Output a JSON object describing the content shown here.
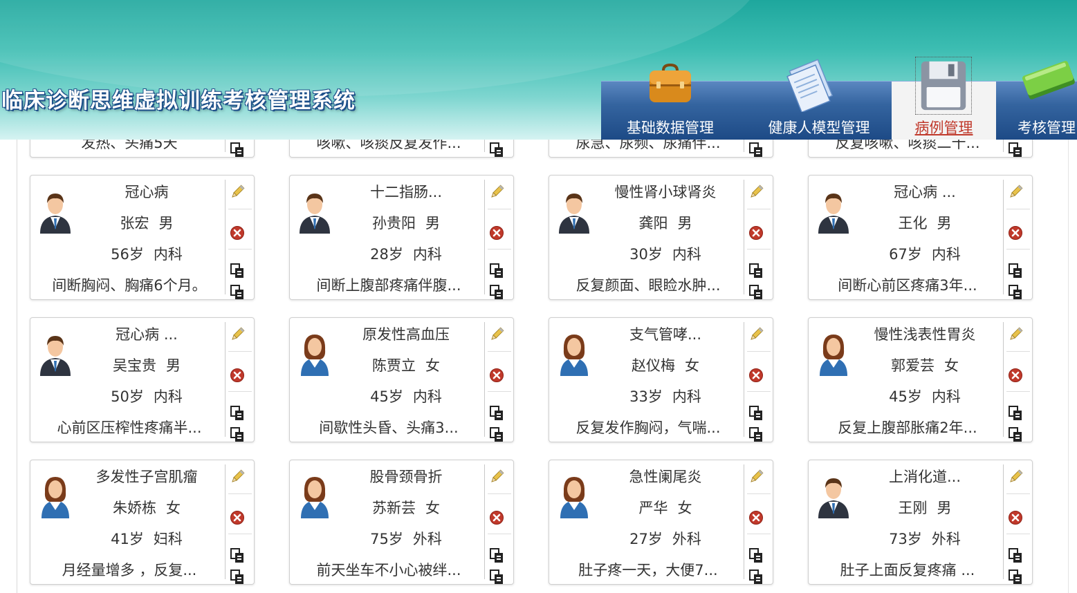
{
  "header": {
    "app_title": "临床诊断思维虚拟训练考核管理系统",
    "nav": [
      {
        "label": "基础数据管理",
        "icon": "briefcase-icon"
      },
      {
        "label": "健康人模型管理",
        "icon": "documents-icon"
      },
      {
        "label": "病例管理",
        "icon": "floppy-disk-icon",
        "active": true
      },
      {
        "label": "考核管理",
        "icon": "book-icon"
      }
    ]
  },
  "partial_row": [
    {
      "desc": "发热、头痛5天"
    },
    {
      "desc": "咳嗽、咳痰反复发作..."
    },
    {
      "desc": "尿急、尿频、尿痛伴..."
    },
    {
      "desc": "反复咳嗽、咳痰二十..."
    }
  ],
  "cases": [
    {
      "diagnosis": "冠心病",
      "name": "张宏",
      "gender": "男",
      "age": "56岁",
      "dept": "内科",
      "desc": "间断胸闷、胸痛6个月。"
    },
    {
      "diagnosis": "十二指肠...",
      "name": "孙贵阳",
      "gender": "男",
      "age": "28岁",
      "dept": "内科",
      "desc": "间断上腹部疼痛伴腹..."
    },
    {
      "diagnosis": "慢性肾小球肾炎",
      "name": "龚阳",
      "gender": "男",
      "age": "30岁",
      "dept": "内科",
      "desc": "反复颜面、眼睑水肿..."
    },
    {
      "diagnosis": "冠心病 ...",
      "name": "王化",
      "gender": "男",
      "age": "67岁",
      "dept": "内科",
      "desc": "间断心前区疼痛3年..."
    },
    {
      "diagnosis": "冠心病 ...",
      "name": "吴宝贵",
      "gender": "男",
      "age": "50岁",
      "dept": "内科",
      "desc": "心前区压榨性疼痛半..."
    },
    {
      "diagnosis": "原发性高血压",
      "name": "陈贾立",
      "gender": "女",
      "age": "45岁",
      "dept": "内科",
      "desc": "间歇性头昏、头痛3..."
    },
    {
      "diagnosis": "支气管哮...",
      "name": "赵仪梅",
      "gender": "女",
      "age": "33岁",
      "dept": "内科",
      "desc": "反复发作胸闷，气喘..."
    },
    {
      "diagnosis": "慢性浅表性胃炎",
      "name": "郭爱芸",
      "gender": "女",
      "age": "45岁",
      "dept": "内科",
      "desc": "反复上腹部胀痛2年..."
    },
    {
      "diagnosis": "多发性子宫肌瘤",
      "name": "朱娇栋",
      "gender": "女",
      "age": "41岁",
      "dept": "妇科",
      "desc": "月经量增多 ，反复..."
    },
    {
      "diagnosis": "股骨颈骨折",
      "name": "苏新芸",
      "gender": "女",
      "age": "75岁",
      "dept": "外科",
      "desc": "前天坐车不小心被绊..."
    },
    {
      "diagnosis": "急性阑尾炎",
      "name": "严华",
      "gender": "女",
      "age": "27岁",
      "dept": "外科",
      "desc": "肚子疼一天，大便7..."
    },
    {
      "diagnosis": "上消化道...",
      "name": "王刚",
      "gender": "男",
      "age": "73岁",
      "dept": "外科",
      "desc": "肚子上面反复疼痛 ..."
    }
  ],
  "colors": {
    "accent": "#1d4a86",
    "active_nav_text": "#c0392b",
    "delete": "#c0392b"
  }
}
